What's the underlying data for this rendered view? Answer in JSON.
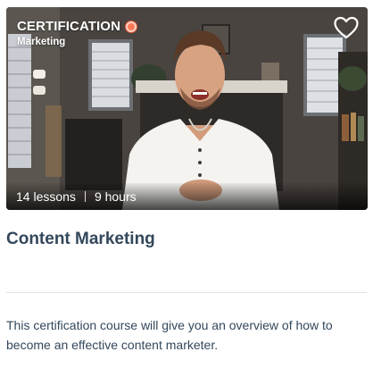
{
  "course": {
    "badge": "CERTIFICATION",
    "category": "Marketing",
    "lessons": "14 lessons",
    "duration": "9 hours",
    "title": "Content Marketing",
    "description": "This certification course will give you an overview of how to become an effective content marketer."
  },
  "colors": {
    "title": "#33475b",
    "accent_dot": "#ff7a59",
    "divider": "#dfe3eb"
  },
  "icons": {
    "favorite": "heart-outline-icon",
    "certification": "certification-dot-icon"
  }
}
